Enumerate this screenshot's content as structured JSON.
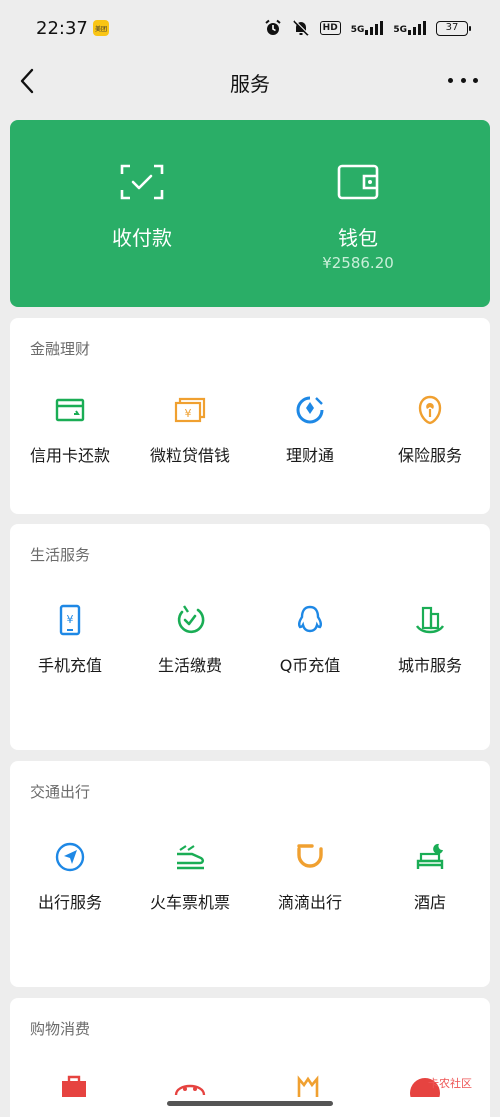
{
  "status_bar": {
    "time": "22:37",
    "app_badge": "美团",
    "hd": "HD",
    "net1": "5G",
    "net2": "5G",
    "battery": "37"
  },
  "nav": {
    "title": "服务"
  },
  "hero": {
    "pay": {
      "label": "收付款",
      "icon": "scan-pay-icon"
    },
    "wallet": {
      "label": "钱包",
      "balance": "¥2586.20",
      "icon": "wallet-icon"
    }
  },
  "sections": {
    "finance": {
      "title": "金融理财",
      "items": [
        {
          "label": "信用卡还款",
          "icon": "credit-card-icon",
          "color": "#1aad55"
        },
        {
          "label": "微粒贷借钱",
          "icon": "loan-icon",
          "color": "#f0a030"
        },
        {
          "label": "理财通",
          "icon": "wealth-icon",
          "color": "#1e88e5"
        },
        {
          "label": "保险服务",
          "icon": "insurance-icon",
          "color": "#f0a030"
        }
      ]
    },
    "life": {
      "title": "生活服务",
      "items": [
        {
          "label": "手机充值",
          "icon": "phone-recharge-icon",
          "color": "#1e88e5"
        },
        {
          "label": "生活缴费",
          "icon": "utility-icon",
          "color": "#1aad55"
        },
        {
          "label": "Q币充值",
          "icon": "qq-icon",
          "color": "#1e88e5"
        },
        {
          "label": "城市服务",
          "icon": "city-icon",
          "color": "#1aad55"
        }
      ]
    },
    "transport": {
      "title": "交通出行",
      "items": [
        {
          "label": "出行服务",
          "icon": "navigation-icon",
          "color": "#1e88e5"
        },
        {
          "label": "火车票机票",
          "icon": "train-icon",
          "color": "#1aad55"
        },
        {
          "label": "滴滴出行",
          "icon": "didi-icon",
          "color": "#f0a030"
        },
        {
          "label": "酒店",
          "icon": "hotel-icon",
          "color": "#1aad55"
        }
      ]
    },
    "shopping": {
      "title": "购物消费"
    }
  },
  "watermark": "卡农社区"
}
